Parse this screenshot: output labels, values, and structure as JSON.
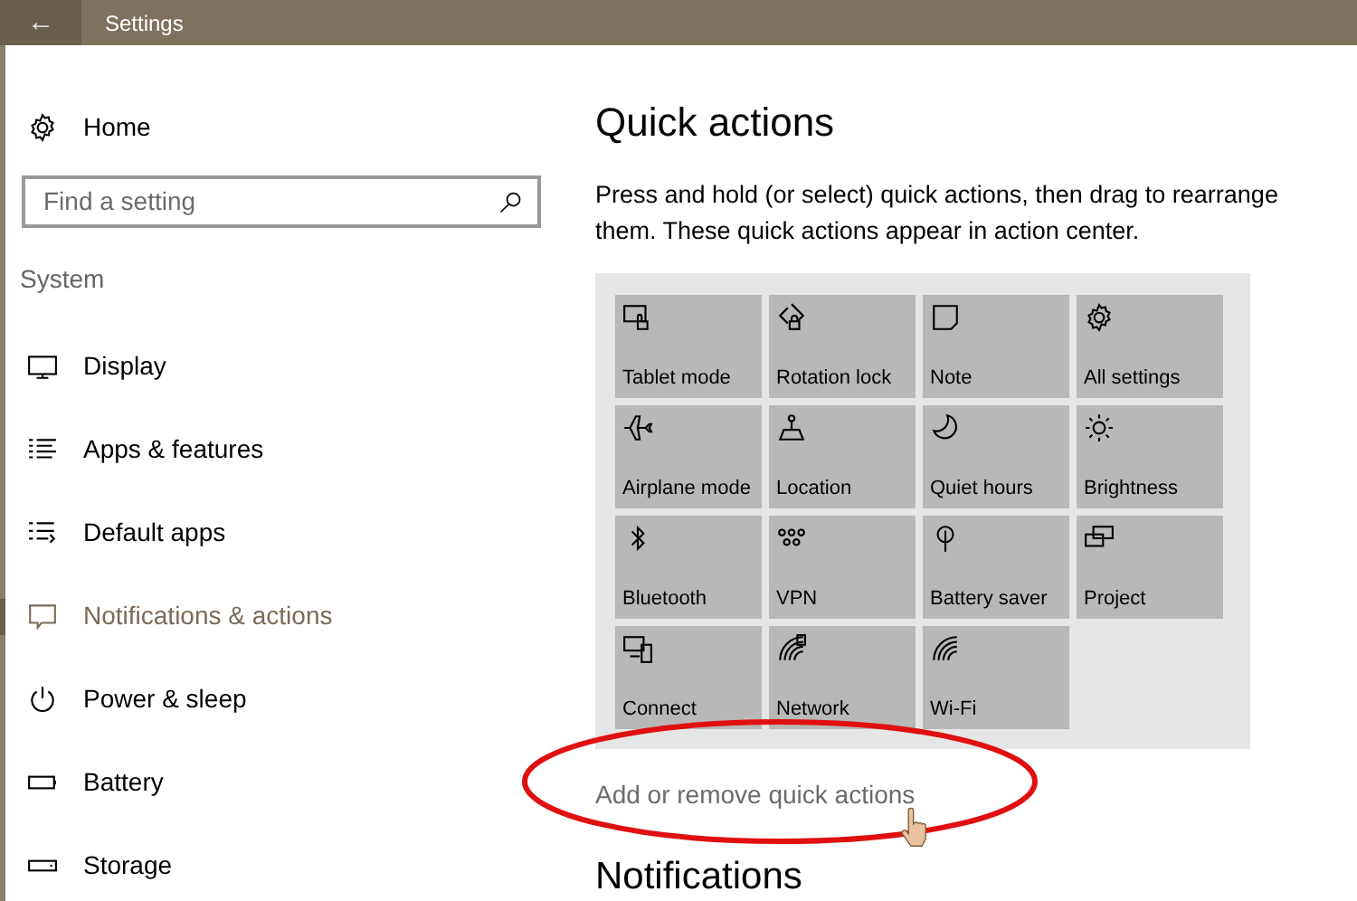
{
  "window": {
    "title": "Settings",
    "back": "←"
  },
  "sidebar": {
    "home": "Home",
    "search": {
      "placeholder": "Find a setting"
    },
    "group": "System",
    "items": [
      {
        "label": "Display",
        "selected": false
      },
      {
        "label": "Apps & features",
        "selected": false
      },
      {
        "label": "Default apps",
        "selected": false
      },
      {
        "label": "Notifications & actions",
        "selected": true
      },
      {
        "label": "Power & sleep",
        "selected": false
      },
      {
        "label": "Battery",
        "selected": false
      },
      {
        "label": "Storage",
        "selected": false
      }
    ]
  },
  "content": {
    "title": "Quick actions",
    "description": "Press and hold (or select) quick actions, then drag to rearrange them. These quick actions appear in action center.",
    "tiles": [
      {
        "label": "Tablet mode"
      },
      {
        "label": "Rotation lock"
      },
      {
        "label": "Note"
      },
      {
        "label": "All settings"
      },
      {
        "label": "Airplane mode"
      },
      {
        "label": "Location"
      },
      {
        "label": "Quiet hours"
      },
      {
        "label": "Brightness"
      },
      {
        "label": "Bluetooth"
      },
      {
        "label": "VPN"
      },
      {
        "label": "Battery saver"
      },
      {
        "label": "Project"
      },
      {
        "label": "Connect"
      },
      {
        "label": "Network"
      },
      {
        "label": "Wi-Fi"
      }
    ],
    "link": "Add or remove quick actions",
    "next_heading": "Notifications"
  }
}
